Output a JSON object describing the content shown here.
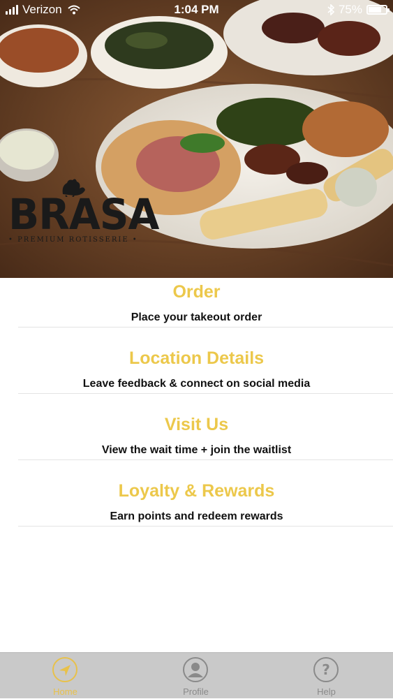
{
  "status_bar": {
    "carrier": "Verizon",
    "time": "1:04 PM",
    "battery_percent": "75%",
    "battery_level": 0.75,
    "icons": [
      "signal-icon",
      "wifi-icon",
      "bluetooth-icon",
      "battery-icon"
    ]
  },
  "hero": {
    "logo_word": "BRASA",
    "logo_tagline": "• PREMIUM ROTISSERIE •"
  },
  "menu": {
    "items": [
      {
        "title": "Order",
        "subtitle": "Place your takeout order"
      },
      {
        "title": "Location Details",
        "subtitle": "Leave feedback & connect on social media"
      },
      {
        "title": "Visit Us",
        "subtitle": "View the wait time + join the waitlist"
      },
      {
        "title": "Loyalty & Rewards",
        "subtitle": "Earn points and redeem rewards"
      }
    ]
  },
  "tab_bar": {
    "tabs": [
      {
        "label": "Home",
        "icon": "navigation-arrow-icon",
        "active": true
      },
      {
        "label": "Profile",
        "icon": "person-icon",
        "active": false
      },
      {
        "label": "Help",
        "icon": "question-mark-icon",
        "active": false
      }
    ]
  },
  "colors": {
    "accent": "#ecc84b",
    "tab_bar_bg": "#c9c9c9",
    "text": "#111111"
  }
}
